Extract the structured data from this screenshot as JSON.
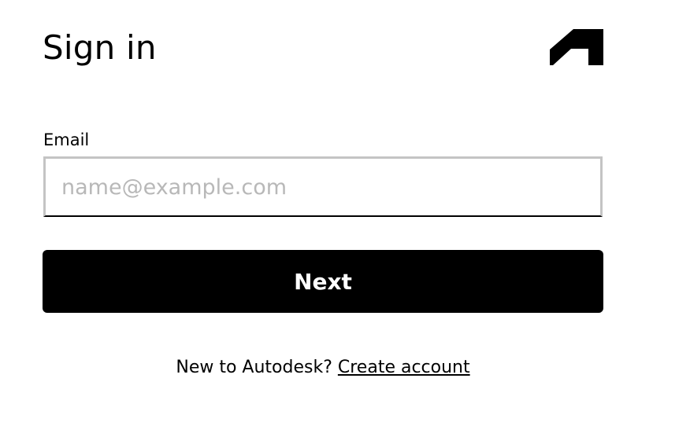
{
  "header": {
    "title": "Sign in",
    "logo_icon": "autodesk-logo-icon"
  },
  "email": {
    "label": "Email",
    "placeholder": "name@example.com",
    "value": ""
  },
  "actions": {
    "next_label": "Next"
  },
  "footer": {
    "prompt": "New to Autodesk?",
    "create_account_label": "Create account"
  },
  "colors": {
    "background": "#ffffff",
    "primary_button": "#000000",
    "primary_button_text": "#ffffff",
    "input_border": "#c4c4c4",
    "placeholder": "#b8b8b8"
  }
}
